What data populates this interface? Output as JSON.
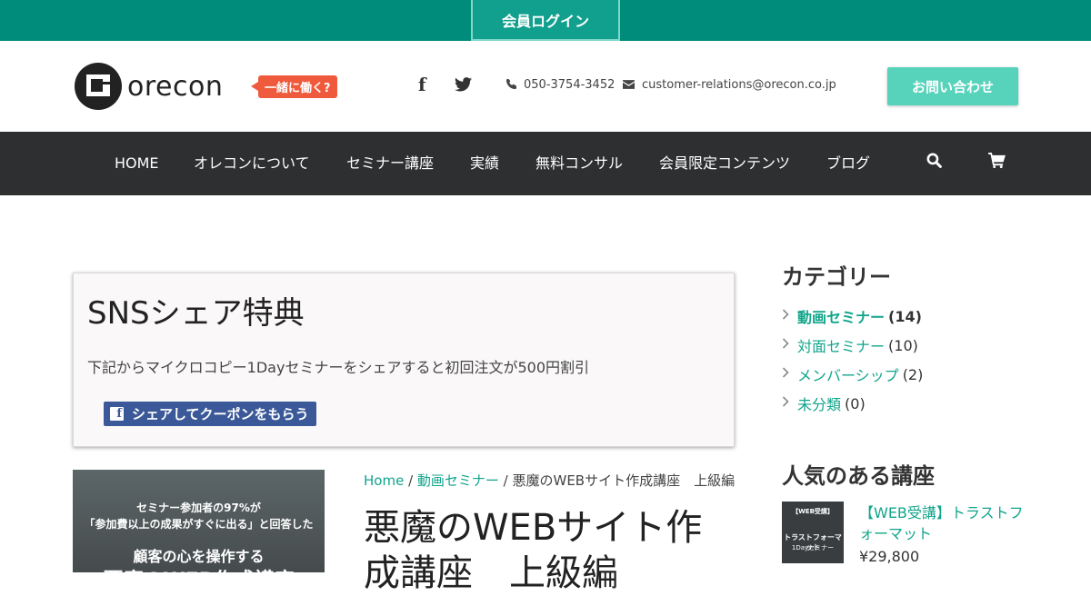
{
  "topbar": {
    "login_label": "会員ログイン"
  },
  "header": {
    "logo_text": "orecon",
    "work_badge": "一緒に働く?",
    "phone": "050-3754-3452",
    "email": "customer-relations@orecon.co.jp",
    "inquiry_label": "お問い合わせ"
  },
  "nav": {
    "items": [
      "HOME",
      "オレコンについて",
      "セミナー講座",
      "実績",
      "無料コンサル",
      "会員限定コンテンツ",
      "ブログ"
    ]
  },
  "share_box": {
    "title": "SNSシェア特典",
    "text": "下記からマイクロコピー1Dayセミナーをシェアすると初回注文が500円割引",
    "button_label": "シェアしてクーポンをもらう"
  },
  "product_image": {
    "line1": "セミナー参加者の97%が",
    "line2": "「参加費以上の成果がすぐに出る」と回答した",
    "line3": "顧客の心を操作する",
    "line4": "悪魔のWEB作成講座"
  },
  "breadcrumb": {
    "home": "Home",
    "sep": " / ",
    "category": "動画セミナー",
    "current": "悪魔のWEBサイト作成講座　上級編"
  },
  "product": {
    "title": "悪魔のWEBサイト作成講座　上級編"
  },
  "sidebar": {
    "categories_heading": "カテゴリー",
    "categories": [
      {
        "name": "動画セミナー",
        "count": "(14)"
      },
      {
        "name": "対面セミナー",
        "count": "(10)"
      },
      {
        "name": "メンバーシップ",
        "count": "(2)"
      },
      {
        "name": "未分類",
        "count": "(0)"
      }
    ],
    "popular_heading": "人気のある講座",
    "popular": {
      "thumb_line1": "【WEB受講】",
      "thumb_line2": "トラストフォーマット",
      "thumb_line3": "1Dayセミナー",
      "title": "【WEB受講】トラストフォーマット",
      "price": "¥29,800"
    }
  },
  "colors": {
    "teal": "#008c7b",
    "accent_link": "#11a58b",
    "nav_bg": "#2d2f30",
    "badge": "#ef5a3c",
    "inquiry": "#57d3bb",
    "facebook": "#3b5998"
  }
}
